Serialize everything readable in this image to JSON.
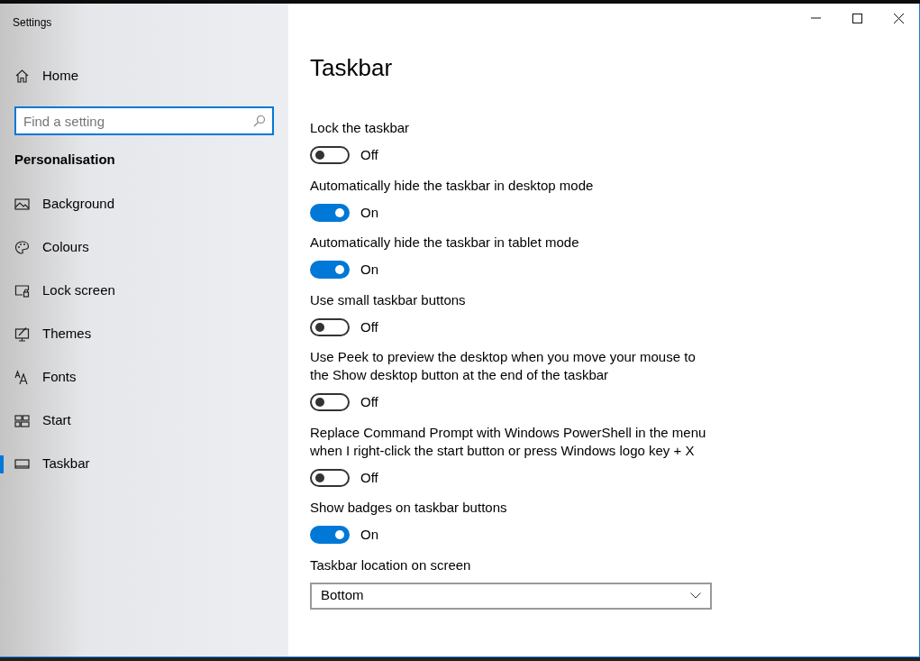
{
  "window": {
    "title": "Settings"
  },
  "sidebar": {
    "home": "Home",
    "search": {
      "placeholder": "Find a setting"
    },
    "section": "Personalisation",
    "items": [
      {
        "label": "Background",
        "kind": "background",
        "selected": false
      },
      {
        "label": "Colours",
        "kind": "colours",
        "selected": false
      },
      {
        "label": "Lock screen",
        "kind": "lockscreen",
        "selected": false
      },
      {
        "label": "Themes",
        "kind": "themes",
        "selected": false
      },
      {
        "label": "Fonts",
        "kind": "fonts",
        "selected": false
      },
      {
        "label": "Start",
        "kind": "start",
        "selected": false
      },
      {
        "label": "Taskbar",
        "kind": "taskbar",
        "selected": true
      }
    ]
  },
  "page": {
    "title": "Taskbar",
    "settings": [
      {
        "label": "Lock the taskbar",
        "on": false,
        "state": "Off"
      },
      {
        "label": "Automatically hide the taskbar in desktop mode",
        "on": true,
        "state": "On"
      },
      {
        "label": "Automatically hide the taskbar in tablet mode",
        "on": true,
        "state": "On"
      },
      {
        "label": "Use small taskbar buttons",
        "on": false,
        "state": "Off"
      },
      {
        "label": "Use Peek to preview the desktop when you move your mouse to the Show desktop button at the end of the taskbar",
        "on": false,
        "state": "Off"
      },
      {
        "label": "Replace Command Prompt with Windows PowerShell in the menu when I right-click the start button or press Windows logo key + X",
        "on": false,
        "state": "Off"
      },
      {
        "label": "Show badges on taskbar buttons",
        "on": true,
        "state": "On"
      }
    ],
    "location": {
      "label": "Taskbar location on screen",
      "value": "Bottom"
    }
  }
}
